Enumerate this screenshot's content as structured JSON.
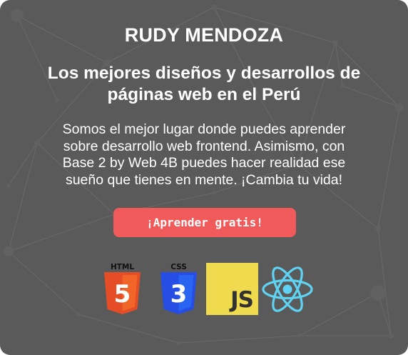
{
  "hero": {
    "brand": "RUDY MENDOZA",
    "headline_line1": "Los mejores diseños y desarrollos de",
    "headline_line2": "páginas web en el Perú",
    "lead_line1": "Somos el mejor lugar donde puedes aprender",
    "lead_line2": "sobre desarrollo web frontend. Asimismo, con",
    "lead_line3": "Base 2 by Web 4B puedes hacer realidad ese",
    "lead_line4": "sueño que tienes en mente. ¡Cambia tu vida!",
    "cta_label": "¡Aprender gratis!"
  },
  "tech_logos": {
    "html": {
      "icon": "html5-icon",
      "label": "HTML",
      "glyph": "5"
    },
    "css": {
      "icon": "css3-icon",
      "label": "CSS",
      "glyph": "3"
    },
    "js": {
      "icon": "javascript-icon",
      "label": "JS"
    },
    "react": {
      "icon": "react-icon"
    }
  },
  "colors": {
    "card_background": "#5a5a5a",
    "cta_background": "#f15a5a",
    "html_orange": "#e44d26",
    "css_blue": "#264de4",
    "js_yellow": "#f0db4f",
    "react_cyan": "#5ed3f3"
  }
}
